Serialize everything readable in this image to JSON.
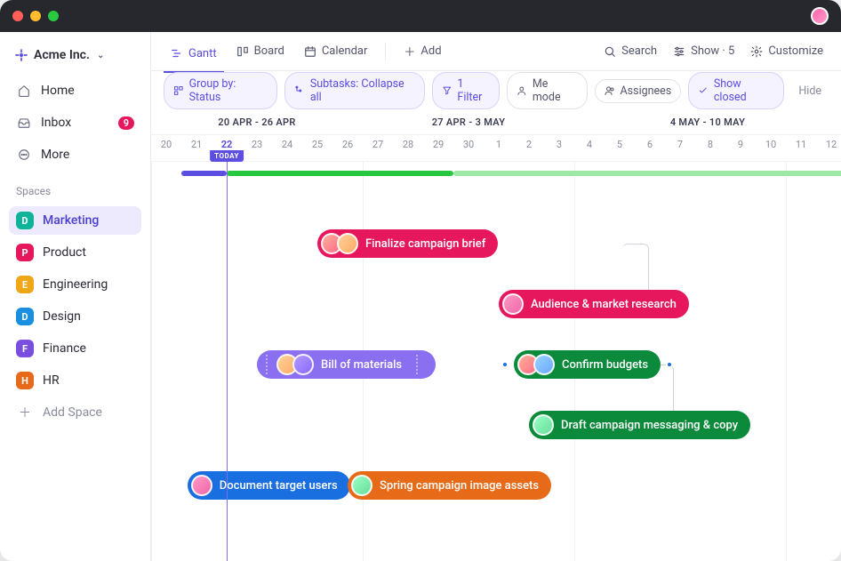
{
  "workspace": {
    "name": "Acme Inc."
  },
  "nav": {
    "home": "Home",
    "inbox": "Inbox",
    "inbox_count": "9",
    "more": "More"
  },
  "spaces_label": "Spaces",
  "spaces": [
    {
      "initial": "D",
      "label": "Marketing",
      "color": "#0fb39a"
    },
    {
      "initial": "P",
      "label": "Product",
      "color": "#e6175c"
    },
    {
      "initial": "E",
      "label": "Engineering",
      "color": "#f0a717"
    },
    {
      "initial": "D",
      "label": "Design",
      "color": "#1a8fe0"
    },
    {
      "initial": "F",
      "label": "Finance",
      "color": "#7a4fe0"
    },
    {
      "initial": "H",
      "label": "HR",
      "color": "#e66a17"
    }
  ],
  "add_space": "Add Space",
  "views": {
    "gantt": "Gantt",
    "board": "Board",
    "calendar": "Calendar",
    "add": "Add"
  },
  "toolbar": {
    "search": "Search",
    "show": "Show · 5",
    "customize": "Customize"
  },
  "filters": {
    "group_by": "Group by: Status",
    "subtasks": "Subtasks: Collapse all",
    "filter": "1 Filter",
    "me_mode": "Me mode",
    "assignees": "Assignees",
    "show_closed": "Show closed",
    "hide": "Hide"
  },
  "timeline": {
    "weeks": [
      "20 APR - 26 APR",
      "27 APR - 3 MAY",
      "4 MAY - 10 MAY"
    ],
    "days": [
      "20",
      "21",
      "22",
      "23",
      "24",
      "25",
      "26",
      "27",
      "28",
      "29",
      "30",
      "1",
      "2",
      "3",
      "4",
      "5",
      "6",
      "7",
      "8",
      "9",
      "10",
      "11",
      "12"
    ],
    "today_index": 2,
    "today_label": "TODAY"
  },
  "tasks": {
    "finalize": "Finalize campaign brief",
    "audience": "Audience & market research",
    "bom": "Bill of materials",
    "budgets": "Confirm budgets",
    "messaging": "Draft campaign messaging & copy",
    "document": "Document target users",
    "assets": "Spring campaign image assets"
  },
  "chart_data": {
    "type": "gantt",
    "date_range": {
      "start": "2020-04-20",
      "end": "2020-05-12"
    },
    "today": "2020-04-22",
    "progress_segments": [
      {
        "status": "complete-purple",
        "start": "2020-04-21",
        "end": "2020-04-22"
      },
      {
        "status": "complete-green",
        "start": "2020-04-22",
        "end": "2020-04-30"
      },
      {
        "status": "remaining",
        "start": "2020-04-30",
        "end": "2020-05-12"
      }
    ],
    "tasks": [
      {
        "name": "Finalize campaign brief",
        "start": "2020-04-25",
        "end": "2020-04-30",
        "color": "#e6175c",
        "assignees": 2
      },
      {
        "name": "Audience & market research",
        "start": "2020-05-01",
        "end": "2020-05-06",
        "color": "#e6175c",
        "assignees": 1,
        "depends_on": "Finalize campaign brief"
      },
      {
        "name": "Bill of materials",
        "start": "2020-04-23",
        "end": "2020-04-28",
        "color": "#8a6ff0",
        "assignees": 2,
        "selected": true
      },
      {
        "name": "Confirm budgets",
        "start": "2020-05-02",
        "end": "2020-05-06",
        "color": "#0a8a3a",
        "assignees": 2
      },
      {
        "name": "Draft campaign messaging & copy",
        "start": "2020-05-02",
        "end": "2020-05-10",
        "color": "#0a8a3a",
        "assignees": 1,
        "depends_on": "Confirm budgets"
      },
      {
        "name": "Document target users",
        "start": "2020-04-21",
        "end": "2020-04-25",
        "color": "#1a6fe0",
        "assignees": 1
      },
      {
        "name": "Spring campaign image assets",
        "start": "2020-04-26",
        "end": "2020-05-02",
        "color": "#e66a17",
        "assignees": 1
      }
    ]
  }
}
